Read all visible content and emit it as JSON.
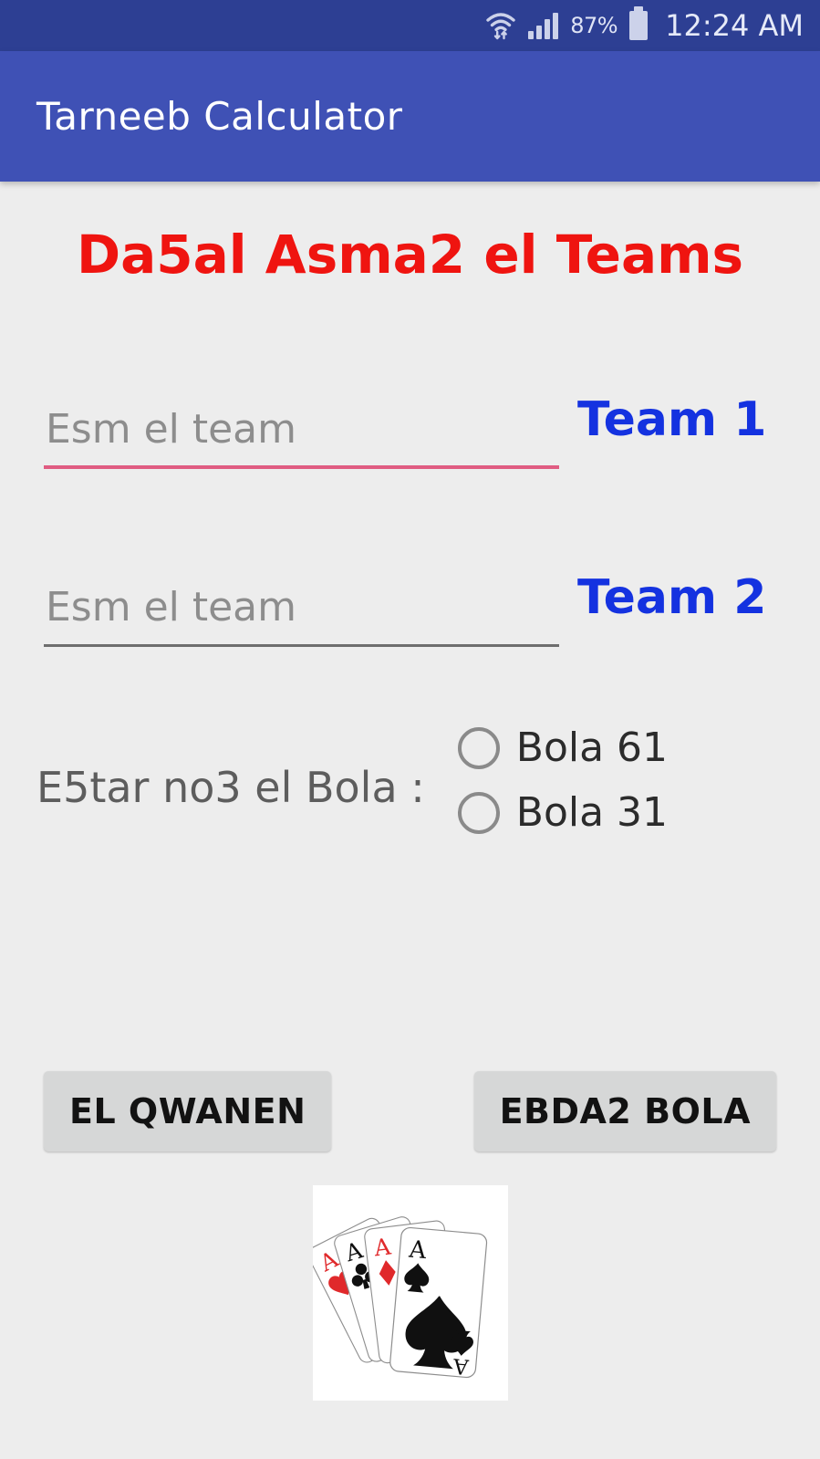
{
  "status_bar": {
    "wifi_icon": "wifi-with-transfer-arrows-icon",
    "signal_icon": "cellular-signal-icon",
    "battery_percent": "87%",
    "battery_icon": "battery-icon",
    "clock": "12:24 AM"
  },
  "app_bar": {
    "title": "Tarneeb Calculator"
  },
  "main": {
    "headline": "Da5al Asma2 el Teams",
    "fields": [
      {
        "placeholder": "Esm el team",
        "value": "",
        "label": "Team 1",
        "underline_state": "error"
      },
      {
        "placeholder": "Esm el team",
        "value": "",
        "label": "Team 2",
        "underline_state": "normal"
      }
    ],
    "radio": {
      "question": "E5tar no3 el Bola :",
      "options": [
        {
          "label": "Bola 61",
          "checked": false
        },
        {
          "label": "Bola 31",
          "checked": false
        }
      ]
    },
    "buttons": {
      "rules": "EL QWANEN",
      "start": "EBDA2 BOLA"
    },
    "image": {
      "name": "four-aces-cards-image"
    }
  },
  "colors": {
    "status_bar": "#2d3f93",
    "app_bar": "#3f51b5",
    "page_background": "#ededed",
    "headline_red": "#ef1410",
    "team_label_blue": "#1432e0",
    "error_underline": "#e05c82",
    "normal_underline": "#6e6e6e",
    "button_background": "#d6d7d7",
    "radio_border": "#8a8a8a",
    "card_red": "#e0292b",
    "card_black": "#101010"
  }
}
